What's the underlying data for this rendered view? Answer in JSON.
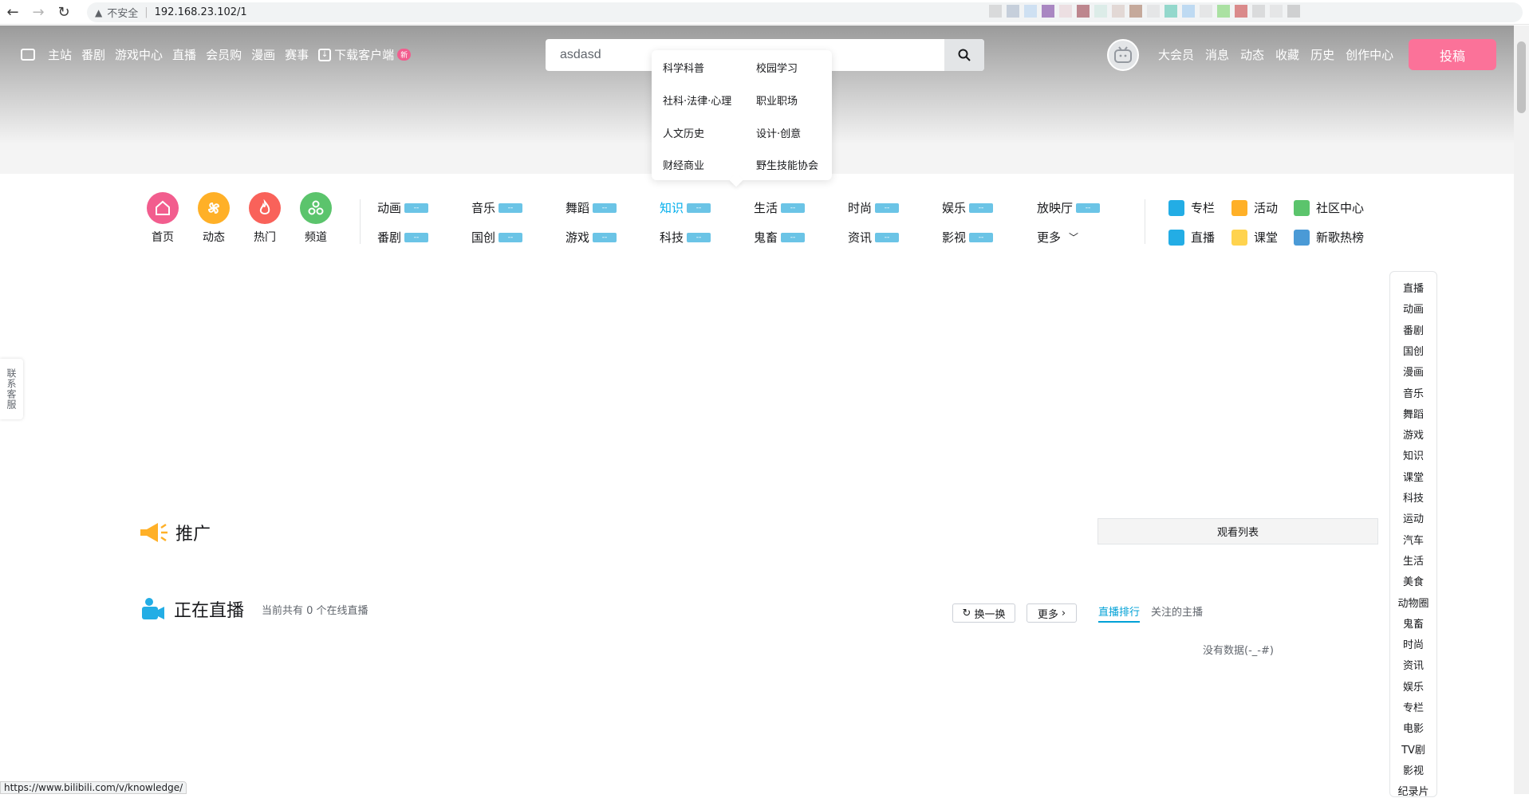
{
  "browser": {
    "insecure_label": "不安全",
    "url": "192.168.23.102/1",
    "status_url": "https://www.bilibili.com/v/knowledge/"
  },
  "top_nav": {
    "items": [
      "主站",
      "番剧",
      "游戏中心",
      "直播",
      "会员购",
      "漫画",
      "赛事"
    ],
    "download_label": "下载客户端",
    "new_badge": "新"
  },
  "search": {
    "value": "asdasd"
  },
  "right_nav": {
    "items": [
      "大会员",
      "消息",
      "动态",
      "收藏",
      "历史",
      "创作中心"
    ]
  },
  "upload_label": "投稿",
  "dropdown": {
    "items": [
      "科学科普",
      "校园学习",
      "社科·法律·心理",
      "职业职场",
      "人文历史",
      "设计·创意",
      "财经商业",
      "野生技能协会"
    ]
  },
  "quick_links": [
    {
      "label": "首页",
      "color": "#f25d8e"
    },
    {
      "label": "动态",
      "color": "#ffb027"
    },
    {
      "label": "热门",
      "color": "#f9625a"
    },
    {
      "label": "频道",
      "color": "#5bc46c"
    }
  ],
  "categories_row1": [
    "动画",
    "音乐",
    "舞蹈",
    "知识",
    "生活",
    "时尚",
    "娱乐",
    "放映厅"
  ],
  "categories_row2": [
    "番剧",
    "国创",
    "游戏",
    "科技",
    "鬼畜",
    "资讯",
    "影视",
    "更多"
  ],
  "category_count": "--",
  "extras": [
    "专栏",
    "活动",
    "社区中心",
    "直播",
    "课堂",
    "新歌热榜"
  ],
  "contact_label": "联系客服",
  "promo": {
    "title": "推广",
    "watch_list": "观看列表"
  },
  "live": {
    "title": "正在直播",
    "sub": "当前共有 0 个在线直播",
    "refresh": "换一换",
    "more": "更多",
    "tab_rank": "直播排行",
    "tab_follow": "关注的主播",
    "nodata": "没有数据(-_-#)"
  },
  "elevator": [
    "直播",
    "动画",
    "番剧",
    "国创",
    "漫画",
    "音乐",
    "舞蹈",
    "游戏",
    "知识",
    "课堂",
    "科技",
    "运动",
    "汽车",
    "生活",
    "美食",
    "动物圈",
    "鬼畜",
    "时尚",
    "资讯",
    "娱乐",
    "专栏",
    "电影",
    "TV剧",
    "影视",
    "纪录片"
  ],
  "colors": {
    "accent": "#00aeec",
    "pink": "#fb7299",
    "count_badge": "#6bc4e6"
  }
}
